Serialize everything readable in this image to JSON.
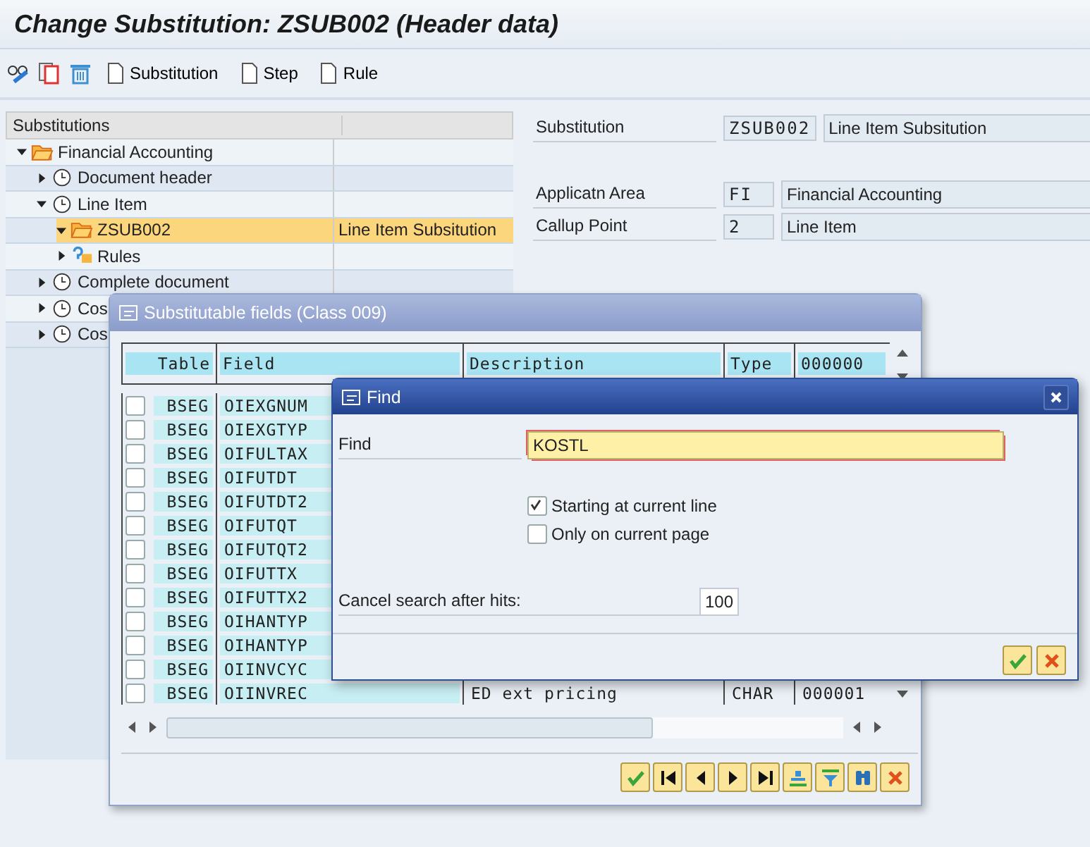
{
  "title": "Change Substitution: ZSUB002 (Header data)",
  "toolbar_buttons": [
    "Substitution",
    "Step",
    "Rule"
  ],
  "tree": {
    "column": "Substitutions",
    "items": [
      {
        "label": "Financial Accounting",
        "kind": "folder",
        "expanded": true,
        "selected": false,
        "children": [
          {
            "label": "Document header",
            "kind": "event",
            "expanded": false,
            "selected": false
          },
          {
            "label": "Line Item",
            "kind": "event",
            "expanded": true,
            "selected": false,
            "children": [
              {
                "label": "ZSUB002",
                "kind": "folder",
                "expanded": true,
                "selected": true,
                "description": "Line Item Subsitution"
              },
              {
                "label": "Rules",
                "kind": "rules",
                "expanded": false,
                "selected": false
              }
            ]
          },
          {
            "label": "Complete document",
            "kind": "event",
            "expanded": false,
            "selected": false
          },
          {
            "label": "Cos",
            "kind": "event",
            "expanded": false,
            "selected": false
          },
          {
            "label": "Cos",
            "kind": "event",
            "expanded": false,
            "selected": false
          }
        ]
      }
    ]
  },
  "header_fields": [
    {
      "label": "Substitution",
      "value": "ZSUB002",
      "text": "Line Item Subsitution"
    },
    {
      "label": "Applicatn Area",
      "value": "FI",
      "text": "Financial Accounting"
    },
    {
      "label": "Callup Point",
      "value": "2",
      "text": "Line Item"
    }
  ],
  "fields_dialog": {
    "title": "Substitutable fields (Class 009)",
    "columns": [
      "Table",
      "Field",
      "Description",
      "Type",
      "000000"
    ],
    "rows": [
      {
        "table": "BSEG",
        "field": "OIEXGNUM",
        "checked": false
      },
      {
        "table": "BSEG",
        "field": "OIEXGTYP",
        "checked": false
      },
      {
        "table": "BSEG",
        "field": "OIFULTAX",
        "checked": false
      },
      {
        "table": "BSEG",
        "field": "OIFUTDT",
        "checked": false
      },
      {
        "table": "BSEG",
        "field": "OIFUTDT2",
        "checked": false
      },
      {
        "table": "BSEG",
        "field": "OIFUTQT",
        "checked": false
      },
      {
        "table": "BSEG",
        "field": "OIFUTQT2",
        "checked": false
      },
      {
        "table": "BSEG",
        "field": "OIFUTTX",
        "checked": false
      },
      {
        "table": "BSEG",
        "field": "OIFUTTX2",
        "checked": false
      },
      {
        "table": "BSEG",
        "field": "OIHANTYP",
        "checked": false
      },
      {
        "table": "BSEG",
        "field": "OIHANTYP",
        "checked": false
      },
      {
        "table": "BSEG",
        "field": "OIINVCYC",
        "checked": false
      },
      {
        "table": "BSEG",
        "field": "OIINVREC",
        "description": "ED ext pricing",
        "type": "CHAR",
        "length": "000001",
        "checked": false
      }
    ]
  },
  "find_dialog": {
    "title": "Find",
    "find_label": "Find",
    "find_value": "KOSTL",
    "options": [
      {
        "label": "Starting at current line",
        "checked": true
      },
      {
        "label": "Only on current page",
        "checked": false
      }
    ],
    "cancel_label": "Cancel search after hits:",
    "cancel_value": "100"
  }
}
